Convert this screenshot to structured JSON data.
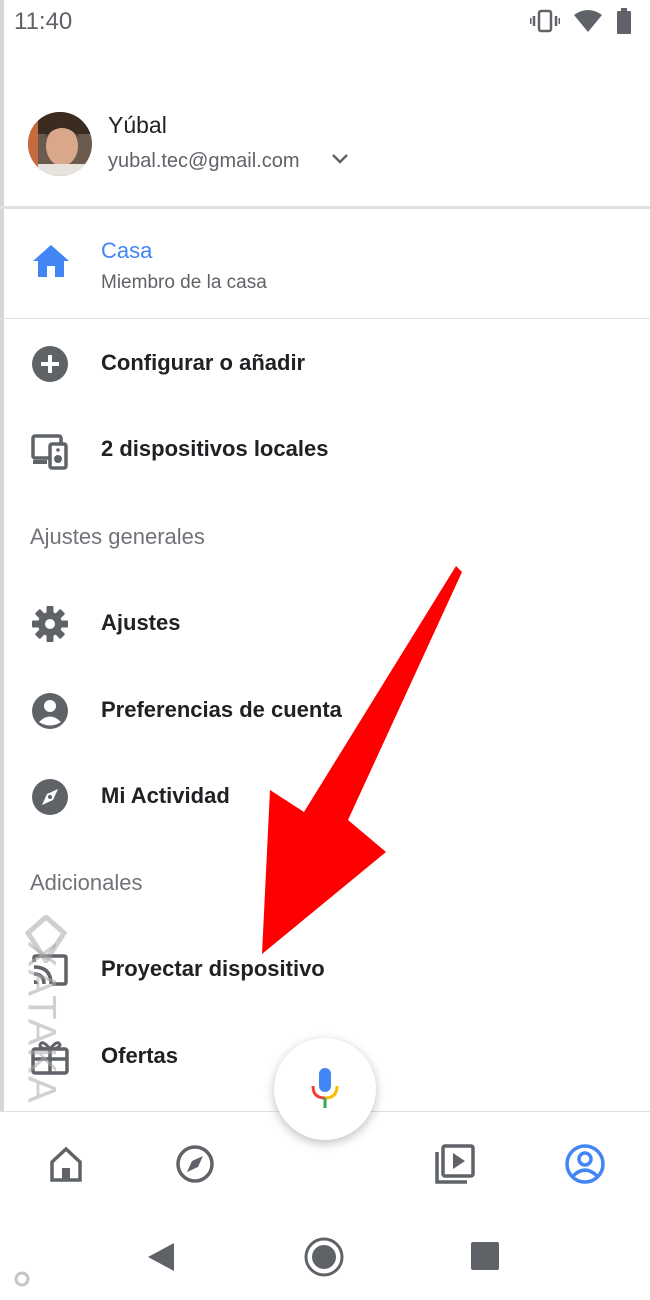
{
  "status": {
    "time": "11:40"
  },
  "account": {
    "name": "Yúbal",
    "email": "yubal.tec@gmail.com"
  },
  "home": {
    "title": "Casa",
    "subtitle": "Miembro de la casa"
  },
  "menu": {
    "setup": "Configurar o añadir",
    "local_devices": "2 dispositivos locales",
    "section_general": "Ajustes generales",
    "settings": "Ajustes",
    "account_prefs": "Preferencias de cuenta",
    "activity": "Mi Actividad",
    "section_extras": "Adicionales",
    "cast": "Proyectar dispositivo",
    "offers": "Ofertas"
  },
  "watermark": {
    "text": "XATAKA BASICS"
  },
  "colors": {
    "accent": "#4285f4",
    "arrow": "#ff0000",
    "icon": "#5f6368"
  }
}
